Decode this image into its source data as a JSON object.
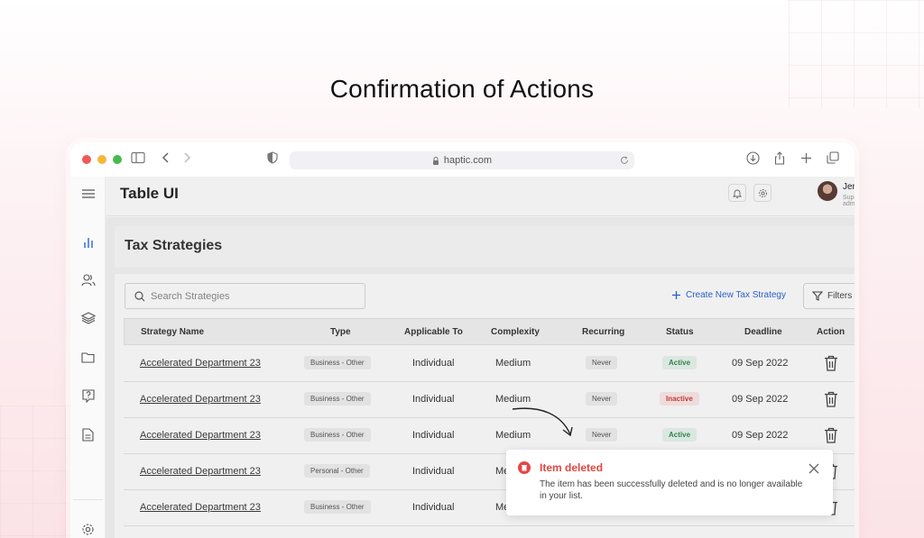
{
  "headline": "Confirmation of Actions",
  "browser": {
    "url": "haptic.com",
    "traffic_lights": [
      "#ee5b57",
      "#f6b63e",
      "#49b94e"
    ]
  },
  "app": {
    "title": "Table UI",
    "user": {
      "name": "Jenna",
      "role": "Super admin"
    },
    "sidebar_icons": [
      "menu-icon",
      "chart-icon",
      "users-icon",
      "layers-icon",
      "folder-icon",
      "help-icon",
      "document-icon",
      "settings-icon"
    ]
  },
  "page": {
    "title": "Tax Strategies",
    "search_placeholder": "Search Strategies",
    "create_label": "Create New Tax Strategy",
    "filters_label": "Filters"
  },
  "table": {
    "columns": [
      "Strategy Name",
      "Type",
      "Applicable To",
      "Complexity",
      "Recurring",
      "Status",
      "Deadline",
      "Action"
    ],
    "rows": [
      {
        "name": "Accelerated Department 23",
        "type": "Business - Other",
        "applicable": "Individual",
        "complexity": "Medium",
        "recurring": "Never",
        "status": "Active",
        "deadline": "09 Sep 2022"
      },
      {
        "name": "Accelerated Department 23",
        "type": "Business - Other",
        "applicable": "Individual",
        "complexity": "Medium",
        "recurring": "Never",
        "status": "Inactive",
        "deadline": "09 Sep 2022"
      },
      {
        "name": "Accelerated Department 23",
        "type": "Business - Other",
        "applicable": "Individual",
        "complexity": "Medium",
        "recurring": "Never",
        "status": "Active",
        "deadline": "09 Sep 2022"
      },
      {
        "name": "Accelerated Department 23",
        "type": "Personal - Other",
        "applicable": "Individual",
        "complexity": "Me",
        "recurring": "",
        "status": "",
        "deadline": ""
      },
      {
        "name": "Accelerated Department 23",
        "type": "Business - Other",
        "applicable": "Individual",
        "complexity": "Me",
        "recurring": "",
        "status": "",
        "deadline": ""
      }
    ]
  },
  "toast": {
    "title": "Item deleted",
    "body": "The item has been successfully deleted and is no longer available in your list."
  }
}
